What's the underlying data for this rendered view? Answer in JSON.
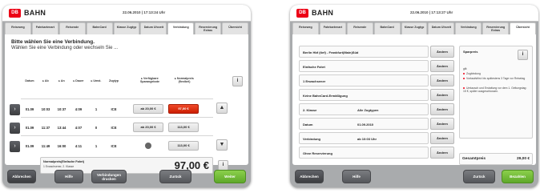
{
  "colors": {
    "brand_red": "#ec0016",
    "accent_green": "#6ab635",
    "selected_price": "#e0260a"
  },
  "left": {
    "brand": "BAHN",
    "datetime": "22.06.2010 | 17:13:24 Uhr",
    "tabs": [
      "Reiseweg",
      "Fahrkartenart",
      "Reisende",
      "BahnCard",
      "Klasse Zugtyp",
      "Datum Uhrzeit",
      "Verbindung",
      "Reservierung Extras",
      "Übersicht"
    ],
    "active_tab": "Verbindung",
    "prompt_title": "Bitte wählen Sie eine Verbindung.",
    "prompt_sub": "Wählen Sie eine Verbindung oder wechseln Sie ...",
    "columns": [
      "Datum",
      "▸ Ab",
      "▸ An",
      "▸ Dauer",
      "▸ Umst.",
      "Zugtyp",
      "▸ Verfügbare Sparangebote",
      "▸ Normalpreis (flexibel)"
    ],
    "rows": [
      {
        "date": "01.09",
        "dep": "10:03",
        "arr": "10:37",
        "dur": "4:09",
        "chg": "1",
        "train": "ICE",
        "saver": "ab 20,00 €",
        "normal": "97,00 €",
        "selected": true
      },
      {
        "date": "01.09",
        "dep": "11:37",
        "arr": "13:44",
        "dur": "4:07",
        "chg": "0",
        "train": "ICE",
        "saver": "ab 20,00 €",
        "normal": "113,00 €",
        "selected": false
      },
      {
        "date": "01.09",
        "dep": "11:49",
        "arr": "16:00",
        "dur": "4:11",
        "chg": "1",
        "train": "ICE",
        "saver": "",
        "normal": "113,00 €",
        "selected": false
      }
    ],
    "total_label": "Normalpreis(Einfache Fahrt)",
    "total_sub": "1 Erwachsener, 2. Klasse",
    "total_value": "97,00 €",
    "footer": {
      "cancel": "Abbrechen",
      "help": "Hilfe",
      "print": "Verbindungen drucken",
      "back": "Zurück",
      "next": "Weiter"
    }
  },
  "right": {
    "brand": "BAHN",
    "datetime": "22.06.2010 | 17:13:27 Uhr",
    "tabs": [
      "Reiseweg",
      "Fahrkartenart",
      "Reisende",
      "BahnCard",
      "Klasse Zugtyp",
      "Datum Uhrzeit",
      "Verbindung",
      "Reservierung Extras",
      "Übersicht"
    ],
    "active_tab": "Übersicht",
    "summary": [
      {
        "label": "Berlin Hbf (tief) - Frankfurt(Main)Süd",
        "value": ""
      },
      {
        "label": "Einfache Fahrt",
        "value": ""
      },
      {
        "label": "1 Erwachsener",
        "value": ""
      },
      {
        "label": "Keine BahnCard-Ermäßigung",
        "value": ""
      },
      {
        "label": "2. Klasse",
        "value": "Alle Zugtypen"
      },
      {
        "label": "Datum",
        "value": "01.09.2010"
      },
      {
        "label": "Verbindung",
        "value": "ab 10:03 Uhr"
      },
      {
        "label": "Ohne Reservierung",
        "value": ""
      }
    ],
    "change_label": "Ändern",
    "side_title": "Sparpreis",
    "side_notes": [
      "gilt:",
      "Zugbindung",
      "Vorkaufsfrist: bis spätestens 3 Tage vor Reisetag",
      "Umtausch und Erstattung vor dem 1. Geltungstag: 15 €, später ausgeschlossen."
    ],
    "total_label": "Gesamtpreis",
    "total_value": "29,00 €",
    "footer": {
      "cancel": "Abbrechen",
      "help": "Hilfe",
      "back": "Zurück",
      "buy": "Bezahlen"
    }
  }
}
